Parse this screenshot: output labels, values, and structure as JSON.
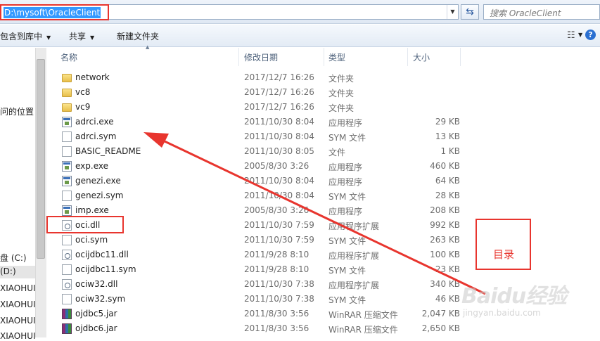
{
  "address_bar": {
    "path": "D:\\mysoft\\OracleClient",
    "search_placeholder": "搜索 OracleClient"
  },
  "toolbar": {
    "include_library": "包含到库中",
    "share": "共享",
    "new_folder": "新建文件夹"
  },
  "nav_pane": {
    "items": [
      {
        "label": "问的位置"
      },
      {
        "label": "盘 (C:)"
      },
      {
        "label": "(D:)"
      },
      {
        "label": "XIAOHUI"
      },
      {
        "label": "XIAOHUI"
      },
      {
        "label": "XIAOHUI"
      },
      {
        "label": "XIAOHUI"
      }
    ]
  },
  "columns": {
    "name": "名称",
    "date": "修改日期",
    "type": "类型",
    "size": "大小"
  },
  "files": [
    {
      "name": "network",
      "date": "2017/12/7 16:26",
      "type": "文件夹",
      "size": "",
      "icon": "folder-icon"
    },
    {
      "name": "vc8",
      "date": "2017/12/7 16:26",
      "type": "文件夹",
      "size": "",
      "icon": "folder-icon"
    },
    {
      "name": "vc9",
      "date": "2017/12/7 16:26",
      "type": "文件夹",
      "size": "",
      "icon": "folder-icon"
    },
    {
      "name": "adrci.exe",
      "date": "2011/10/30 8:04",
      "type": "应用程序",
      "size": "29 KB",
      "icon": "exe-icon"
    },
    {
      "name": "adrci.sym",
      "date": "2011/10/30 8:04",
      "type": "SYM 文件",
      "size": "13 KB",
      "icon": "file-icon"
    },
    {
      "name": "BASIC_README",
      "date": "2011/10/30 8:05",
      "type": "文件",
      "size": "1 KB",
      "icon": "file-icon"
    },
    {
      "name": "exp.exe",
      "date": "2005/8/30 3:26",
      "type": "应用程序",
      "size": "460 KB",
      "icon": "exe-icon"
    },
    {
      "name": "genezi.exe",
      "date": "2011/10/30 8:04",
      "type": "应用程序",
      "size": "64 KB",
      "icon": "exe-icon"
    },
    {
      "name": "genezi.sym",
      "date": "2011/10/30 8:04",
      "type": "SYM 文件",
      "size": "28 KB",
      "icon": "file-icon"
    },
    {
      "name": "imp.exe",
      "date": "2005/8/30 3:26",
      "type": "应用程序",
      "size": "208 KB",
      "icon": "exe-icon"
    },
    {
      "name": "oci.dll",
      "date": "2011/10/30 7:59",
      "type": "应用程序扩展",
      "size": "992 KB",
      "icon": "dll-icon"
    },
    {
      "name": "oci.sym",
      "date": "2011/10/30 7:59",
      "type": "SYM 文件",
      "size": "263 KB",
      "icon": "file-icon"
    },
    {
      "name": "ocijdbc11.dll",
      "date": "2011/9/28 8:10",
      "type": "应用程序扩展",
      "size": "100 KB",
      "icon": "dll-icon"
    },
    {
      "name": "ocijdbc11.sym",
      "date": "2011/9/28 8:10",
      "type": "SYM 文件",
      "size": "23 KB",
      "icon": "file-icon"
    },
    {
      "name": "ociw32.dll",
      "date": "2011/10/30 7:38",
      "type": "应用程序扩展",
      "size": "340 KB",
      "icon": "dll-icon"
    },
    {
      "name": "ociw32.sym",
      "date": "2011/10/30 7:38",
      "type": "SYM 文件",
      "size": "46 KB",
      "icon": "file-icon"
    },
    {
      "name": "ojdbc5.jar",
      "date": "2011/8/30 3:56",
      "type": "WinRAR 压缩文件",
      "size": "2,047 KB",
      "icon": "jar-icon"
    },
    {
      "name": "ojdbc6.jar",
      "date": "2011/8/30 3:56",
      "type": "WinRAR 压缩文件",
      "size": "2,650 KB",
      "icon": "jar-icon"
    }
  ],
  "annotation": {
    "label": "目录",
    "color": "#e8352e"
  },
  "watermark": {
    "brand": "Baidu经验",
    "url": "jingyan.baidu.com"
  }
}
